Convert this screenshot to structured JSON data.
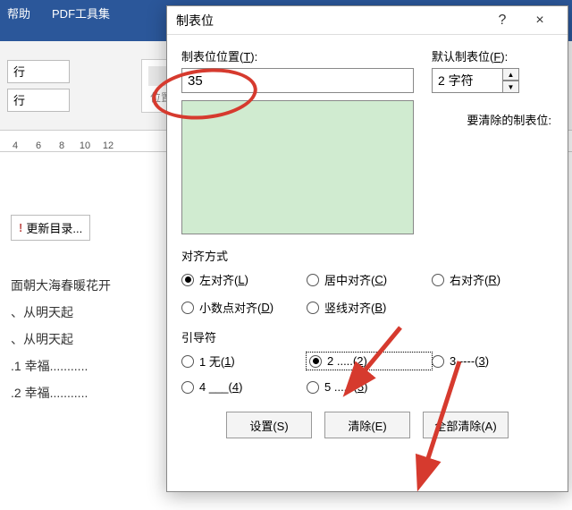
{
  "ribbon": {
    "help": "帮助",
    "pdf": "PDF工具集",
    "row_label": "行",
    "position_label": "位置"
  },
  "ruler": {
    "marks": [
      "4",
      "6",
      "8",
      "10",
      "12"
    ]
  },
  "doc": {
    "toc_update": "更新目录...",
    "lines": [
      "面朝大海春暖花开",
      "、从明天起",
      "、从明天起",
      ".1 幸福...........",
      ".2 幸福..........."
    ]
  },
  "dialog": {
    "title": "制表位",
    "help_icon": "?",
    "close_icon": "×",
    "tab_pos_label_pre": "制表位位置(",
    "tab_pos_label_key": "T",
    "tab_pos_label_post": "):",
    "tab_pos_value": "35",
    "default_label_pre": "默认制表位(",
    "default_label_key": "F",
    "default_label_post": "):",
    "default_value": "2 字符",
    "clear_label": "要清除的制表位:",
    "align_section": "对齐方式",
    "align": {
      "left": {
        "text": "左对齐(",
        "key": "L",
        "post": ")"
      },
      "center": {
        "text": "居中对齐(",
        "key": "C",
        "post": ")"
      },
      "right": {
        "text": "右对齐(",
        "key": "R",
        "post": ")"
      },
      "decimal": {
        "text": "小数点对齐(",
        "key": "D",
        "post": ")"
      },
      "bar": {
        "text": "竖线对齐(",
        "key": "B",
        "post": ")"
      }
    },
    "leader_section": "引导符",
    "leader": {
      "none": {
        "text": "1 无(",
        "key": "1",
        "post": ")"
      },
      "dots": {
        "text": "2 .....(",
        "key": "2",
        "post": ")"
      },
      "dashes": {
        "text": "3 ----(",
        "key": "3",
        "post": ")"
      },
      "under": {
        "text": "4 ___(",
        "key": "4",
        "post": ")"
      },
      "ldots": {
        "text": "5 ......(",
        "key": "5",
        "post": ")"
      }
    },
    "buttons": {
      "set": "设置(S)",
      "clear": "清除(E)",
      "clear_all": "全部清除(A)"
    }
  }
}
